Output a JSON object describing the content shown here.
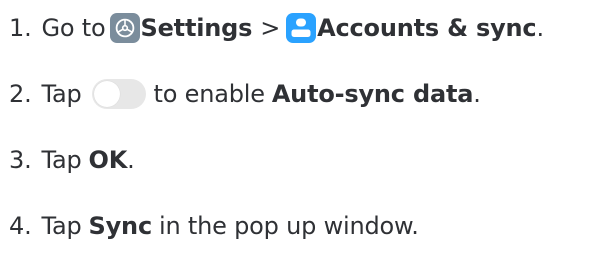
{
  "steps": [
    {
      "number": "1.",
      "go_to": "Go to",
      "settings_icon": "settings-gear-icon",
      "settings": "Settings",
      "separator": ">",
      "accounts_icon": "accounts-person-icon",
      "accounts": "Accounts & sync",
      "period": "."
    },
    {
      "number": "2.",
      "tap": "Tap",
      "toggle_icon": "toggle-switch-icon",
      "toggle_state": "off",
      "to_enable": "to enable",
      "auto_sync": "Auto-sync data",
      "period": "."
    },
    {
      "number": "3.",
      "tap": "Tap",
      "ok": "OK",
      "period": "."
    },
    {
      "number": "4.",
      "tap": "Tap",
      "sync": "Sync",
      "rest": "in the pop up window."
    }
  ],
  "colors": {
    "text": "#2f3135",
    "settings_tile": "#7b8d9c",
    "accounts_tile": "#2aa2ff",
    "toggle_track": "#e7e7e7"
  }
}
